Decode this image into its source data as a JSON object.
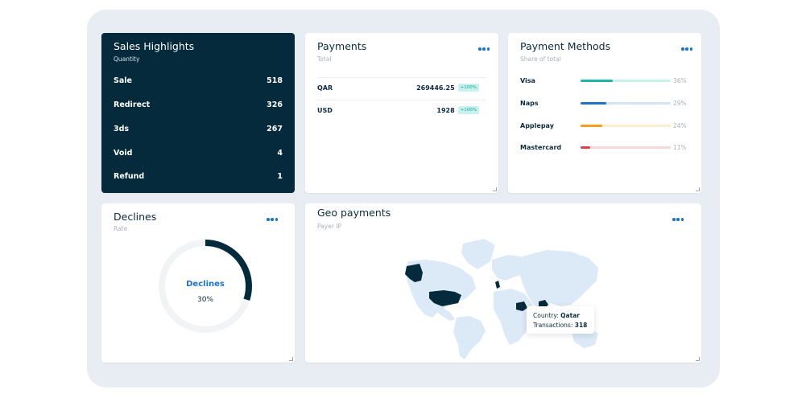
{
  "sales": {
    "title": "Sales Highlights",
    "subtitle": "Quantity",
    "rows": [
      {
        "label": "Sale",
        "value": "518"
      },
      {
        "label": "Redirect",
        "value": "326"
      },
      {
        "label": "3ds",
        "value": "267"
      },
      {
        "label": "Void",
        "value": "4"
      },
      {
        "label": "Refund",
        "value": "1"
      }
    ]
  },
  "payments": {
    "title": "Payments",
    "subtitle": "Total",
    "rows": [
      {
        "currency": "QAR",
        "amount": "269446.25",
        "change": "+100%"
      },
      {
        "currency": "USD",
        "amount": "1928",
        "change": "+100%"
      }
    ]
  },
  "methods": {
    "title": "Payment Methods",
    "subtitle": "Share of total",
    "rows": [
      {
        "name": "Visa",
        "pct": "36%",
        "fraction": 0.36,
        "color": "#1db6a9",
        "track": "#c9f1ed"
      },
      {
        "name": "Naps",
        "pct": "29%",
        "fraction": 0.29,
        "color": "#1b74c7",
        "track": "#d3e4f3"
      },
      {
        "name": "Applepay",
        "pct": "24%",
        "fraction": 0.24,
        "color": "#f0a21c",
        "track": "#fdecd2"
      },
      {
        "name": "Mastercard",
        "pct": "11%",
        "fraction": 0.11,
        "color": "#e33d4d",
        "track": "#f8d8dc"
      }
    ]
  },
  "declines": {
    "title": "Declines",
    "subtitle": "Rate",
    "center_label": "Declines",
    "center_value": "30%",
    "fraction": 0.3,
    "color": "#052a3b",
    "track_color": "#f1f3f5"
  },
  "geo": {
    "title": "Geo payments",
    "subtitle": "Payer IP",
    "tooltip": {
      "country_label": "Country:",
      "country": "Qatar",
      "tx_label": "Transactions:",
      "tx": "318"
    },
    "land_color": "#dce9f6",
    "highlight_color": "#052a3b"
  },
  "icons": {
    "more": "more-horizontal-icon",
    "resize": "resize-grip-icon"
  }
}
